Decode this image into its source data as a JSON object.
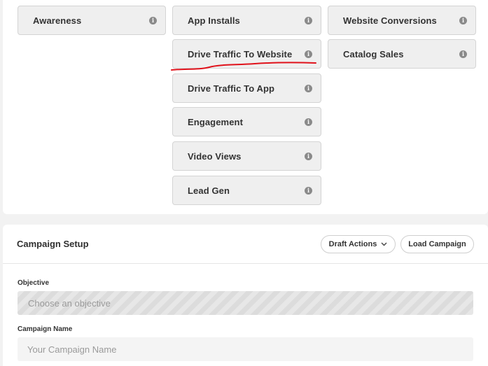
{
  "objectives": {
    "awareness": "Awareness",
    "app_installs": "App Installs",
    "website_conversions": "Website Conversions",
    "drive_traffic_website": "Drive Traffic To Website",
    "catalog_sales": "Catalog Sales",
    "drive_traffic_app": "Drive Traffic To App",
    "engagement": "Engagement",
    "video_views": "Video Views",
    "lead_gen": "Lead Gen",
    "info_glyph": "i"
  },
  "annotation": {
    "color": "#e0121b"
  },
  "campaign_setup": {
    "title": "Campaign Setup",
    "draft_actions_label": "Draft Actions",
    "load_campaign_label": "Load Campaign",
    "objective_label": "Objective",
    "objective_placeholder": "Choose an objective",
    "campaign_name_label": "Campaign Name",
    "campaign_name_placeholder": "Your Campaign Name"
  }
}
